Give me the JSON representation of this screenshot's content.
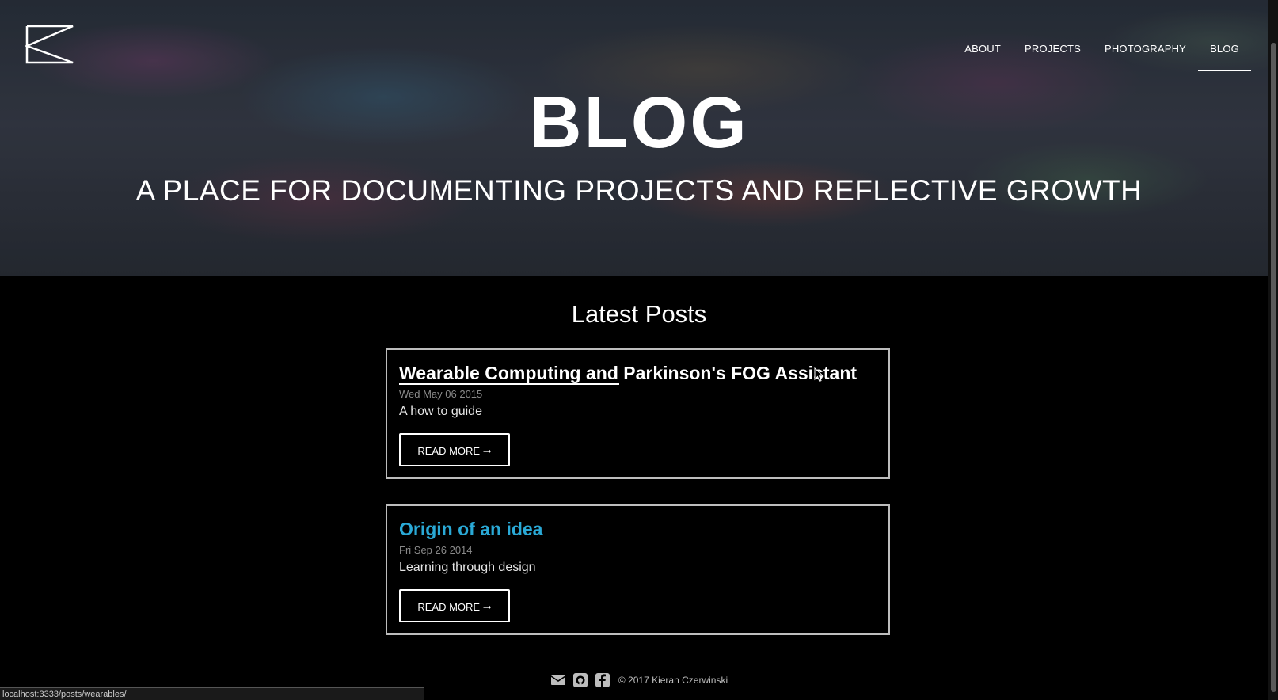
{
  "nav": {
    "items": [
      {
        "label": "ABOUT",
        "active": false
      },
      {
        "label": "PROJECTS",
        "active": false
      },
      {
        "label": "PHOTOGRAPHY",
        "active": false
      },
      {
        "label": "BLOG",
        "active": true
      }
    ]
  },
  "hero": {
    "title": "BLOG",
    "subtitle": "A PLACE FOR DOCUMENTING PROJECTS AND REFLECTIVE GROWTH"
  },
  "main": {
    "heading": "Latest Posts",
    "posts": [
      {
        "title": "Wearable Computing and Parkinson's FOG Assistant",
        "date": "Wed May 06 2015",
        "description": "A how to guide",
        "button": "READ MORE ➞"
      },
      {
        "title": "Origin of an idea",
        "date": "Fri Sep 26 2014",
        "description": "Learning through design",
        "button": "READ MORE ➞"
      }
    ]
  },
  "footer": {
    "icons": [
      "envelope-icon",
      "github-icon",
      "facebook-icon"
    ],
    "copyright": "© 2017 Kieran Czerwinski"
  },
  "status_bar": {
    "url": "localhost:3333/posts/wearables/"
  },
  "colors": {
    "accent": "#2aa9d6",
    "background": "#000000",
    "card_border": "#bdbdbd"
  }
}
